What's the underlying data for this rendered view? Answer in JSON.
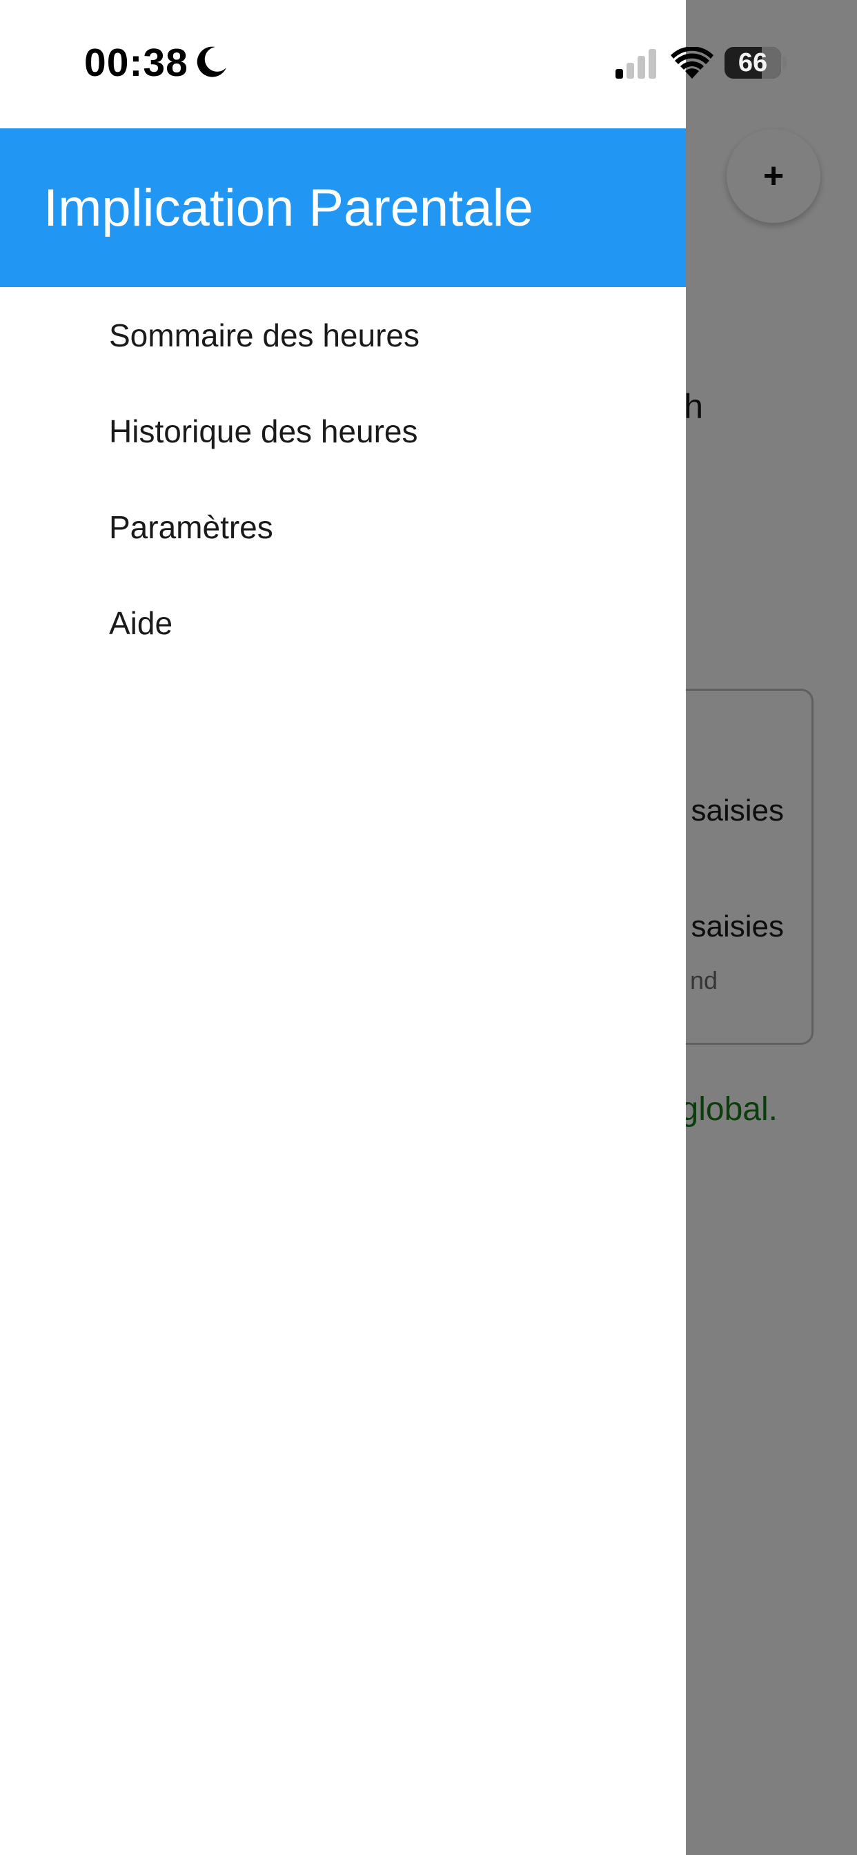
{
  "status_bar": {
    "time": "00:38",
    "battery_level": "66",
    "battery_fraction": 0.66,
    "signal_bars_active": 1,
    "signal_bars_total": 4,
    "icons": [
      "moon-icon",
      "cellular-signal-icon",
      "wifi-icon",
      "battery-icon"
    ]
  },
  "drawer": {
    "title": "Implication Parentale",
    "header_color": "#2196f3",
    "items": [
      {
        "label": "Sommaire des heures"
      },
      {
        "label": "Historique des heures"
      },
      {
        "label": "Paramètres"
      },
      {
        "label": "Aide"
      }
    ]
  },
  "background_page": {
    "add_button_symbol": "+",
    "heading_fragment": "h",
    "card_row1_fragment": "saisies",
    "card_row2_fragment": "saisies",
    "card_row2_sub_fragment": "nd",
    "status_fragment": "global.",
    "status_color": "#1b7a1b"
  }
}
